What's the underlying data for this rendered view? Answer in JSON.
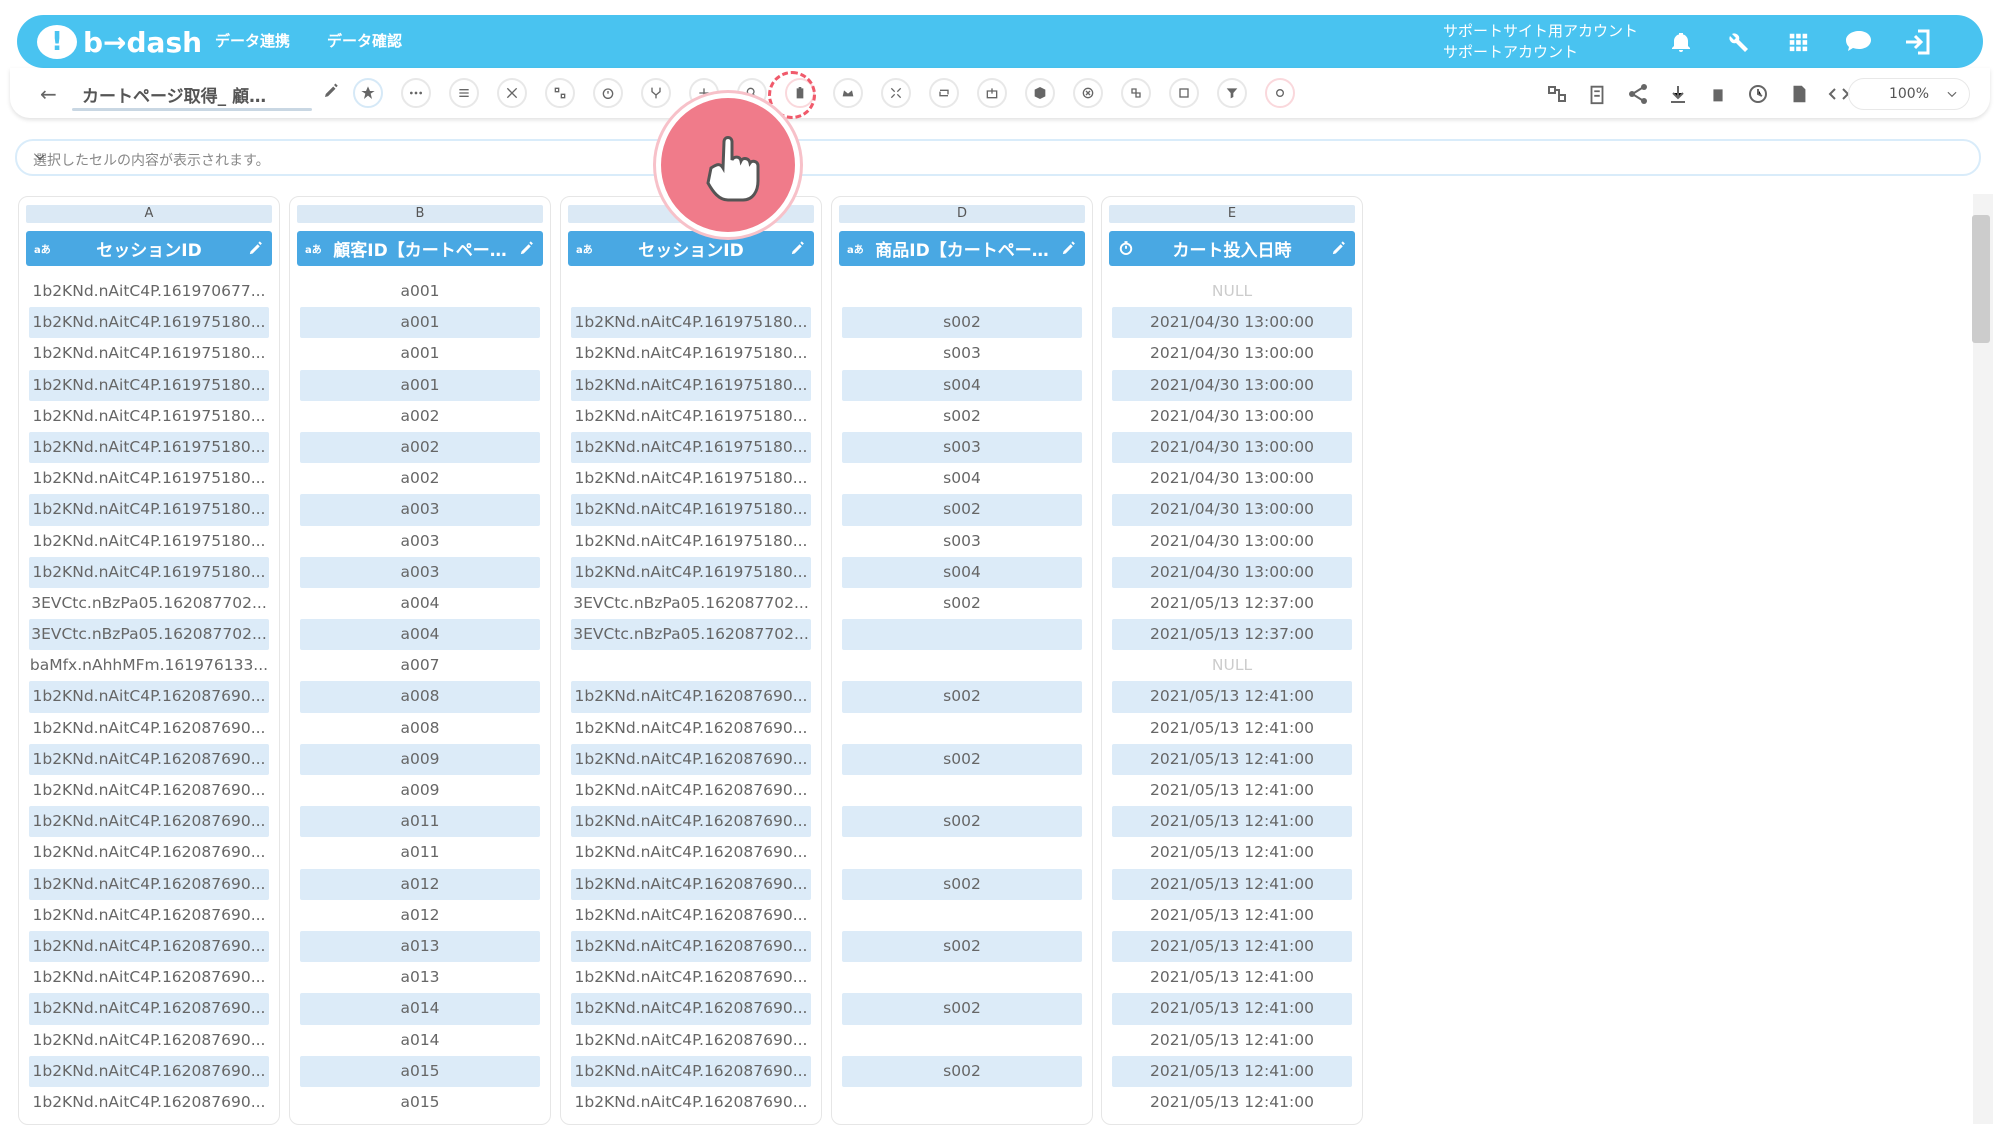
{
  "app": {
    "logo_text": "b→dash",
    "nav": [
      "データ連携",
      "データ確認"
    ],
    "account_line1": "サポートサイト用アカウント",
    "account_line2": "サポートアカウント"
  },
  "toolbar": {
    "back_symbol": "←",
    "page_name": "カートページ取得_ 顧…",
    "zoom": "100%"
  },
  "cellbar": {
    "placeholder": "選択したセルの内容が表示されます。"
  },
  "columns": [
    {
      "letter": "A",
      "type": "aあ",
      "header": "セッションID",
      "cells": [
        "1b2KNd.nAitC4P.161970677...",
        "1b2KNd.nAitC4P.161975180...",
        "1b2KNd.nAitC4P.161975180...",
        "1b2KNd.nAitC4P.161975180...",
        "1b2KNd.nAitC4P.161975180...",
        "1b2KNd.nAitC4P.161975180...",
        "1b2KNd.nAitC4P.161975180...",
        "1b2KNd.nAitC4P.161975180...",
        "1b2KNd.nAitC4P.161975180...",
        "1b2KNd.nAitC4P.161975180...",
        "3EVCtc.nBzPa05.162087702...",
        "3EVCtc.nBzPa05.162087702...",
        "baMfx.nAhhMFm.161976133...",
        "1b2KNd.nAitC4P.162087690...",
        "1b2KNd.nAitC4P.162087690...",
        "1b2KNd.nAitC4P.162087690...",
        "1b2KNd.nAitC4P.162087690...",
        "1b2KNd.nAitC4P.162087690...",
        "1b2KNd.nAitC4P.162087690...",
        "1b2KNd.nAitC4P.162087690...",
        "1b2KNd.nAitC4P.162087690...",
        "1b2KNd.nAitC4P.162087690...",
        "1b2KNd.nAitC4P.162087690...",
        "1b2KNd.nAitC4P.162087690...",
        "1b2KNd.nAitC4P.162087690...",
        "1b2KNd.nAitC4P.162087690...",
        "1b2KNd.nAitC4P.162087690..."
      ]
    },
    {
      "letter": "B",
      "type": "aあ",
      "header": "顧客ID【カートペー…",
      "cells": [
        "a001",
        "a001",
        "a001",
        "a001",
        "a002",
        "a002",
        "a002",
        "a003",
        "a003",
        "a003",
        "a004",
        "a004",
        "a007",
        "a008",
        "a008",
        "a009",
        "a009",
        "a011",
        "a011",
        "a012",
        "a012",
        "a013",
        "a013",
        "a014",
        "a014",
        "a015",
        "a015"
      ]
    },
    {
      "letter": "",
      "type": "aあ",
      "header": "セッションID",
      "cells": [
        "",
        "1b2KNd.nAitC4P.161975180...",
        "1b2KNd.nAitC4P.161975180...",
        "1b2KNd.nAitC4P.161975180...",
        "1b2KNd.nAitC4P.161975180...",
        "1b2KNd.nAitC4P.161975180...",
        "1b2KNd.nAitC4P.161975180...",
        "1b2KNd.nAitC4P.161975180...",
        "1b2KNd.nAitC4P.161975180...",
        "1b2KNd.nAitC4P.161975180...",
        "3EVCtc.nBzPa05.162087702...",
        "3EVCtc.nBzPa05.162087702...",
        "",
        "1b2KNd.nAitC4P.162087690...",
        "1b2KNd.nAitC4P.162087690...",
        "1b2KNd.nAitC4P.162087690...",
        "1b2KNd.nAitC4P.162087690...",
        "1b2KNd.nAitC4P.162087690...",
        "1b2KNd.nAitC4P.162087690...",
        "1b2KNd.nAitC4P.162087690...",
        "1b2KNd.nAitC4P.162087690...",
        "1b2KNd.nAitC4P.162087690...",
        "1b2KNd.nAitC4P.162087690...",
        "1b2KNd.nAitC4P.162087690...",
        "1b2KNd.nAitC4P.162087690...",
        "1b2KNd.nAitC4P.162087690...",
        "1b2KNd.nAitC4P.162087690..."
      ]
    },
    {
      "letter": "D",
      "type": "aあ",
      "header": "商品ID【カートペー…",
      "cells": [
        "",
        "s002",
        "s003",
        "s004",
        "s002",
        "s003",
        "s004",
        "s002",
        "s003",
        "s004",
        "s002",
        "",
        "",
        "s002",
        "",
        "s002",
        "",
        "s002",
        "",
        "s002",
        "",
        "s002",
        "",
        "s002",
        "",
        "s002",
        ""
      ]
    },
    {
      "letter": "E",
      "type": "clock",
      "header": "カート投入日時",
      "cells": [
        "NULL",
        "2021/04/30 13:00:00",
        "2021/04/30 13:00:00",
        "2021/04/30 13:00:00",
        "2021/04/30 13:00:00",
        "2021/04/30 13:00:00",
        "2021/04/30 13:00:00",
        "2021/04/30 13:00:00",
        "2021/04/30 13:00:00",
        "2021/04/30 13:00:00",
        "2021/05/13 12:37:00",
        "2021/05/13 12:37:00",
        "NULL",
        "2021/05/13 12:41:00",
        "2021/05/13 12:41:00",
        "2021/05/13 12:41:00",
        "2021/05/13 12:41:00",
        "2021/05/13 12:41:00",
        "2021/05/13 12:41:00",
        "2021/05/13 12:41:00",
        "2021/05/13 12:41:00",
        "2021/05/13 12:41:00",
        "2021/05/13 12:41:00",
        "2021/05/13 12:41:00",
        "2021/05/13 12:41:00",
        "2021/05/13 12:41:00",
        "2021/05/13 12:41:00"
      ]
    }
  ],
  "colors": {
    "accent": "#49c3f0",
    "header": "#49a8e3",
    "alt_row": "#dcebf8",
    "highlight": "#f05a6b"
  },
  "icons": [
    "bell-icon",
    "wrench-icon",
    "grid-icon",
    "chat-icon",
    "logout-icon"
  ]
}
